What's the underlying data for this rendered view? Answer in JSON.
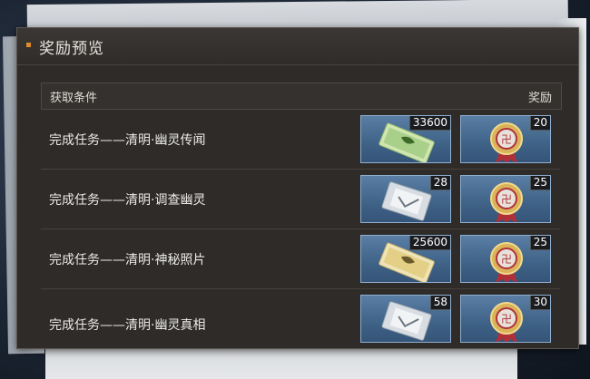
{
  "panel": {
    "title": "奖励预览",
    "header": {
      "condition_label": "获取条件",
      "reward_label": "奖励"
    }
  },
  "tasks": [
    {
      "label": "完成任务——清明·幽灵传闻",
      "rewards": [
        {
          "icon": "green-ticket-icon",
          "count": "33600"
        },
        {
          "icon": "medal-icon",
          "count": "20"
        }
      ]
    },
    {
      "label": "完成任务——清明·调查幽灵",
      "rewards": [
        {
          "icon": "card-pack-icon",
          "count": "28"
        },
        {
          "icon": "medal-icon",
          "count": "25"
        }
      ]
    },
    {
      "label": "完成任务——清明·神秘照片",
      "rewards": [
        {
          "icon": "yellow-ticket-icon",
          "count": "25600"
        },
        {
          "icon": "medal-icon",
          "count": "25"
        }
      ]
    },
    {
      "label": "完成任务——清明·幽灵真相",
      "rewards": [
        {
          "icon": "card-pack-icon",
          "count": "58"
        },
        {
          "icon": "medal-icon",
          "count": "30"
        }
      ]
    }
  ],
  "colors": {
    "accent": "#e08a2a",
    "item_bg": "#4a6f96",
    "panel_bg": "#2e2b29"
  }
}
